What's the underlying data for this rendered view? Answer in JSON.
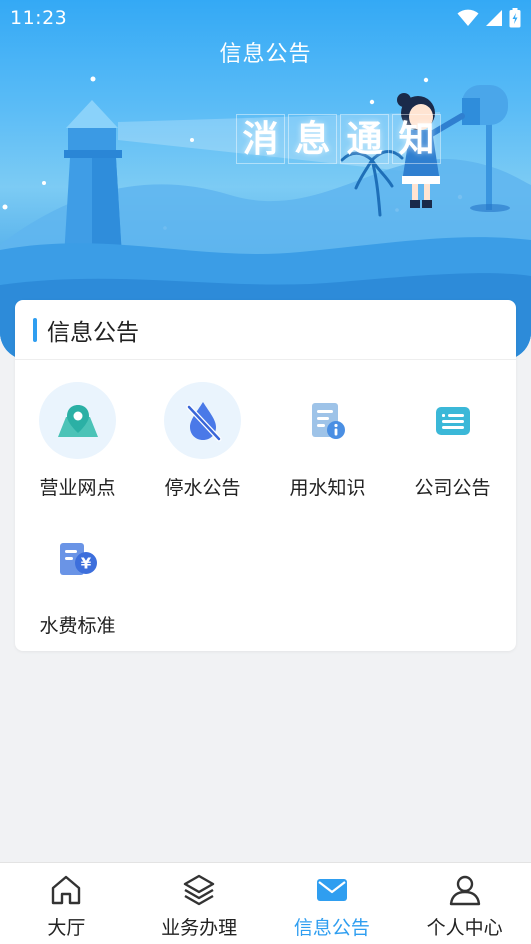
{
  "status_bar": {
    "time": "11:23"
  },
  "header": {
    "title": "信息公告"
  },
  "banner": {
    "headline": [
      "消",
      "息",
      "通",
      "知"
    ]
  },
  "card": {
    "title": "信息公告",
    "items": [
      {
        "label": "营业网点",
        "icon": "location-map-icon"
      },
      {
        "label": "停水公告",
        "icon": "water-off-icon"
      },
      {
        "label": "用水知识",
        "icon": "document-info-icon"
      },
      {
        "label": "公司公告",
        "icon": "notice-list-icon"
      },
      {
        "label": "水费标准",
        "icon": "fee-standard-icon"
      }
    ]
  },
  "bottom_nav": {
    "items": [
      {
        "label": "大厅",
        "icon": "home-icon"
      },
      {
        "label": "业务办理",
        "icon": "layers-icon"
      },
      {
        "label": "信息公告",
        "icon": "mail-icon",
        "active": true
      },
      {
        "label": "个人中心",
        "icon": "user-icon"
      }
    ]
  },
  "colors": {
    "accent": "#2f9ef0",
    "banner": "#34a9f5"
  }
}
